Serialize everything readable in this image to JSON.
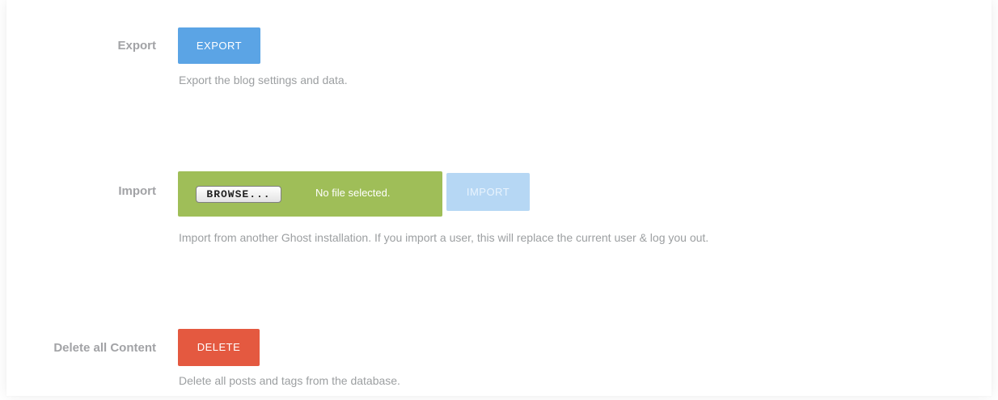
{
  "export": {
    "label": "Export",
    "button": "EXPORT",
    "help": "Export the blog settings and data."
  },
  "import": {
    "label": "Import",
    "browse_button": "BROWSE...",
    "file_status": "No file selected.",
    "button": "IMPORT",
    "help": "Import from another Ghost installation. If you import a user, this will replace the current user & log you out."
  },
  "delete": {
    "label": "Delete all Content",
    "button": "DELETE",
    "help": "Delete all posts and tags from the database."
  },
  "colors": {
    "export_button": "#5ba4e5",
    "import_button_disabled": "#b6d7f4",
    "file_input_background": "#9fbe58",
    "delete_button": "#e45940",
    "label_text": "#a2a3a6",
    "help_text": "#9c9fa1"
  }
}
